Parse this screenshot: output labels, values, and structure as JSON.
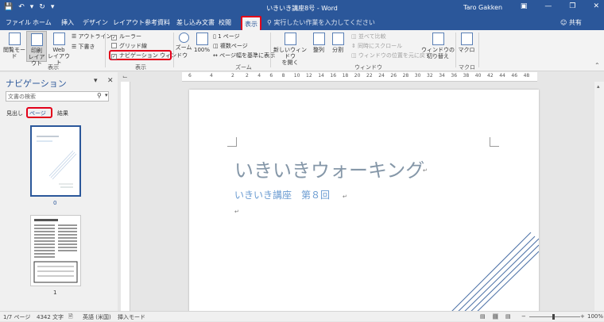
{
  "window": {
    "title": "いきいき講座8号 - Word",
    "user": "Taro Gakken"
  },
  "tabs": [
    "ファイル",
    "ホーム",
    "挿入",
    "デザイン",
    "レイアウト",
    "参考資料",
    "差し込み文書",
    "校閲",
    "表示"
  ],
  "active_tab": "表示",
  "tell_me": "実行したい作業を入力してください",
  "share": "共有",
  "ribbon": {
    "views": {
      "read_mode": "閲覧モード",
      "print_layout": "印刷\nレイアウト",
      "web_layout": "Web\nレイアウト",
      "outline": "アウトライン",
      "draft": "下書き",
      "group": "表示"
    },
    "show": {
      "ruler": "ルーラー",
      "gridlines": "グリッド線",
      "nav_pane": "ナビゲーション ウィンドウ",
      "group": "表示"
    },
    "zoom": {
      "zoom": "ズーム",
      "hundred": "100%",
      "one_page": "1 ページ",
      "multi_page": "複数ページ",
      "page_width": "ページ幅を基準に表示",
      "group": "ズーム"
    },
    "window": {
      "new_window": "新しいウィンドウ\nを開く",
      "arrange": "整列",
      "split": "分割",
      "side_by_side": "並べて比較",
      "sync_scroll": "同時にスクロール",
      "reset_pos": "ウィンドウの位置を元に戻す",
      "switch": "ウィンドウの\n切り替え",
      "group": "ウィンドウ"
    },
    "macros": {
      "macro": "マクロ",
      "group": "マクロ"
    }
  },
  "navigation": {
    "title": "ナビゲーション",
    "search_placeholder": "文書の検索",
    "tabs": [
      "見出し",
      "ページ",
      "結果"
    ],
    "pages": [
      "0",
      "1"
    ]
  },
  "ruler_numbers": [
    "6",
    "4",
    "2",
    "2",
    "4",
    "6",
    "8",
    "10",
    "12",
    "14",
    "16",
    "18",
    "20",
    "22",
    "24",
    "26",
    "28",
    "30",
    "32",
    "34",
    "36",
    "38",
    "40",
    "42",
    "44",
    "46",
    "48"
  ],
  "document": {
    "title": "いきいきウォーキング",
    "subtitle": "いきいき講座　第８回"
  },
  "status": {
    "page": "1/7 ページ",
    "words": "4342 文字",
    "language": "英語 (米国)",
    "mode": "挿入モード",
    "zoom": "100%"
  },
  "colors": {
    "accent": "#2b579a",
    "highlight": "#e2001a",
    "title_text": "#8597a8",
    "subtitle_text": "#6a9bd1"
  }
}
